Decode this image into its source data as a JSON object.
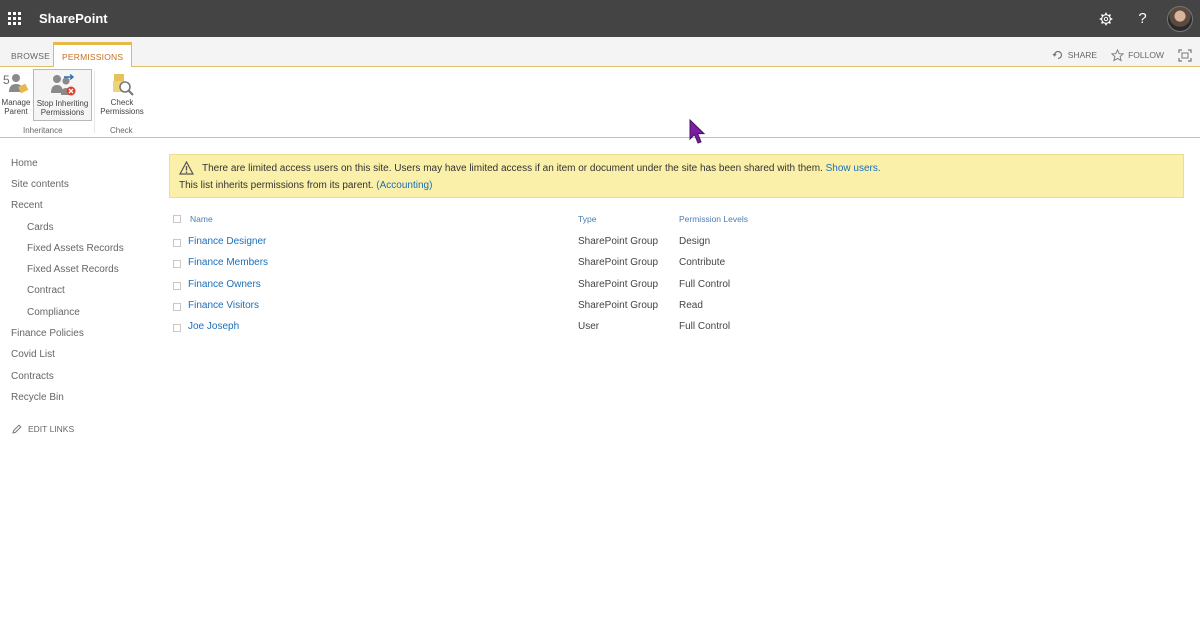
{
  "suitebar": {
    "app_name": "SharePoint",
    "settings_icon": "gear-icon",
    "help_label": "?"
  },
  "ribbon": {
    "tabs": [
      {
        "label": "BROWSE"
      },
      {
        "label": "PERMISSIONS"
      }
    ],
    "actions": {
      "share": "SHARE",
      "follow": "FOLLOW"
    },
    "buttons": {
      "manage_parent": [
        "Manage",
        "Parent"
      ],
      "stop_inheriting": [
        "Stop Inheriting",
        "Permissions"
      ],
      "check_permissions": [
        "Check",
        "Permissions"
      ]
    },
    "groups": {
      "inheritance": "Inheritance",
      "check": "Check"
    },
    "accent_color": "#e8b84a"
  },
  "leftnav": {
    "items": [
      {
        "label": "Home",
        "indent": false
      },
      {
        "label": "Site contents",
        "indent": false
      },
      {
        "label": "Recent",
        "indent": false
      },
      {
        "label": "Cards",
        "indent": true
      },
      {
        "label": "Fixed Assets Records",
        "indent": true
      },
      {
        "label": "Fixed Asset Records",
        "indent": true
      },
      {
        "label": "Contract",
        "indent": true
      },
      {
        "label": "Compliance",
        "indent": true
      },
      {
        "label": "Finance Policies",
        "indent": false
      },
      {
        "label": "Covid List",
        "indent": false
      },
      {
        "label": "Contracts",
        "indent": false
      },
      {
        "label": "Recycle Bin",
        "indent": false
      }
    ],
    "edit_links": "EDIT LINKS"
  },
  "notice": {
    "line1": "There are limited access users on this site. Users may have limited access if an item or document under the site has been shared with them.",
    "show_users": "Show users.",
    "line2": "This list inherits permissions from its parent.",
    "parent_link": "(Accounting)",
    "bg_color": "#faf0a9"
  },
  "table": {
    "headers": {
      "name": "Name",
      "type": "Type",
      "levels": "Permission Levels"
    },
    "rows": [
      {
        "name": "Finance Designer",
        "type": "SharePoint Group",
        "level": "Design"
      },
      {
        "name": "Finance Members",
        "type": "SharePoint Group",
        "level": "Contribute"
      },
      {
        "name": "Finance Owners",
        "type": "SharePoint Group",
        "level": "Full Control"
      },
      {
        "name": "Finance Visitors",
        "type": "SharePoint Group",
        "level": "Read"
      },
      {
        "name": "Joe Joseph",
        "type": "User",
        "level": "Full Control"
      }
    ],
    "link_color": "#1b6fb8"
  }
}
